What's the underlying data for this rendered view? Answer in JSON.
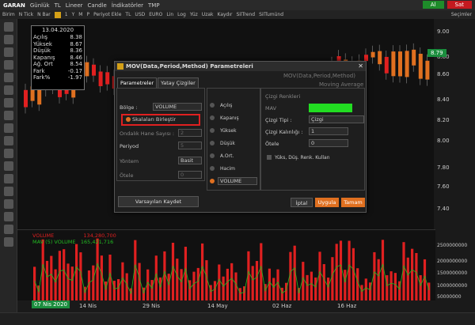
{
  "topbar": {
    "symbol": "GARAN",
    "period": "Günlük",
    "currency": "TL",
    "line": "Lineer",
    "candle": "Candle",
    "indicators": "İndikatörler",
    "tmp": "TMP",
    "buy": "Al",
    "sell": "Sat"
  },
  "toolbar2": {
    "items": [
      "Birim",
      "N Tick",
      "N Bar",
      "1",
      "Y",
      "M",
      "P",
      "Periyot Ekle",
      "TL",
      "USD",
      "EURO",
      "Lin",
      "Log",
      "Yüz",
      "Uzak",
      "Kaydır",
      "SilTrend",
      "SilTumünd"
    ],
    "right": "Seçimler"
  },
  "infobox": {
    "date": "13.04.2020",
    "rows": [
      {
        "k": "Açılış",
        "v": "8.38"
      },
      {
        "k": "Yüksek",
        "v": "8.67"
      },
      {
        "k": "Düşük",
        "v": "8.36"
      },
      {
        "k": "Kapanış",
        "v": "8.46"
      },
      {
        "k": "Ağ. Ort",
        "v": "8.54"
      },
      {
        "k": "Fark",
        "v": "-0.17"
      },
      {
        "k": "Fark%",
        "v": "-1.97"
      }
    ]
  },
  "yaxis": [
    "9.00",
    "8.80",
    "8.60",
    "8.40",
    "8.20",
    "8.00",
    "7.80",
    "7.60",
    "7.40"
  ],
  "price_flag": "8.79",
  "dialog": {
    "title": "MOV(Data,Period,Method) Parametreleri",
    "tabs": [
      "Parametreler",
      "Yatay Çizgiler"
    ],
    "ghost_title": "MOV(Data,Period,Method)",
    "ghost_sub": "Moving Average",
    "bolge_label": "Bölge :",
    "bolge_value": "VOLUME",
    "scale_label": "Skalaları Birleştir",
    "ondalik_label": "Ondalık Hane Sayısı :",
    "ondalik_value": "2",
    "period_label": "Periyod",
    "period_value": "5",
    "method_label": "Yöntem",
    "method_value": "Basit",
    "otele_label": "Ötele",
    "otele_value": "0",
    "sources": [
      "Açılış",
      "Kapanış",
      "Yüksek",
      "Düşük",
      "A.Ort.",
      "Hacim",
      "VOLUME"
    ],
    "colors_title": "Çizgi Renkleri",
    "mav_label": "MAV",
    "line_type_label": "Çizgi Tipi :",
    "line_type_value": "Çizgi",
    "line_width_label": "Çizgi Kalınlığı :",
    "line_width_value": "1",
    "otele2_label": "Ötele",
    "otele2_value": "0",
    "check_label": "Yüks, Düş. Renk. Kullan",
    "save_default": "Varsayılan Kaydet",
    "cancel": "İptal",
    "apply": "Uygula",
    "ok": "Tamam",
    "mav_color": "#22dd22"
  },
  "volume": {
    "legend1": "VOLUME",
    "legend1_value": "134,280,700",
    "legend2": "MAV (5) VOLUME",
    "legend2_value": "165,421,716",
    "axis": [
      "2500000000",
      "2000000000",
      "1500000000",
      "1000000000",
      "50000000"
    ]
  },
  "xaxis": {
    "ticks": [
      "14 Nis",
      "29 Nis",
      "14 May",
      "02 Haz",
      "16 Haz"
    ],
    "date_flag": "07 Nis 2020"
  },
  "colors": {
    "up": "#e07020",
    "down": "#e02020",
    "vol": "#e02020",
    "mav": "#22bb22"
  }
}
